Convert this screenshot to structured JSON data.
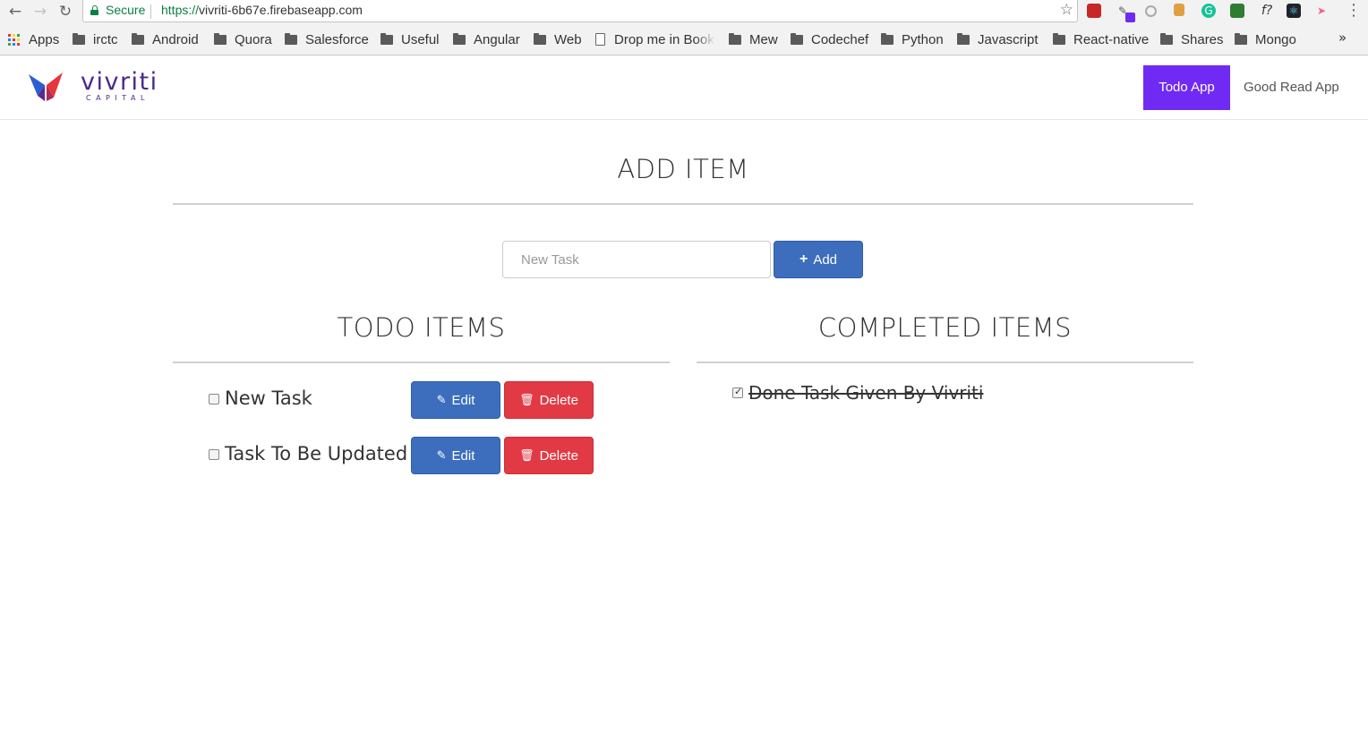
{
  "browser": {
    "secure_label": "Secure",
    "url_scheme": "https://",
    "url_host": "vivriti-6b67e.firebaseapp.com",
    "bookmarks": [
      "Apps",
      "irctc",
      "Android",
      "Quora",
      "Salesforce",
      "Useful",
      "Angular",
      "Web",
      "Drop me in Book",
      "Mew",
      "Codechef",
      "Python",
      "Javascript",
      "React-native",
      "Shares",
      "Mongo"
    ],
    "bookmarks_overflow": "»"
  },
  "navbar": {
    "logo_text": "vivriti",
    "logo_sub": "CAPITAL",
    "links": [
      "Todo App",
      "Good Read App"
    ]
  },
  "add_section": {
    "title": "ADD ITEM",
    "input_placeholder": "New Task",
    "add_label": "Add"
  },
  "todo": {
    "title": "TODO ITEMS",
    "items": [
      {
        "label": "New Task",
        "checked": false
      },
      {
        "label": "Task To Be Updated",
        "checked": false
      }
    ],
    "edit_label": "Edit",
    "delete_label": "Delete"
  },
  "completed": {
    "title": "COMPLETED ITEMS",
    "items": [
      {
        "label": "Done Task Given By Vivriti",
        "checked": true
      }
    ]
  },
  "colors": {
    "active_nav": "#6f2bf3",
    "primary": "#3c6ebd",
    "danger": "#e23a45",
    "secure_green": "#0b8043",
    "brand_purple": "#4b2a8a"
  }
}
